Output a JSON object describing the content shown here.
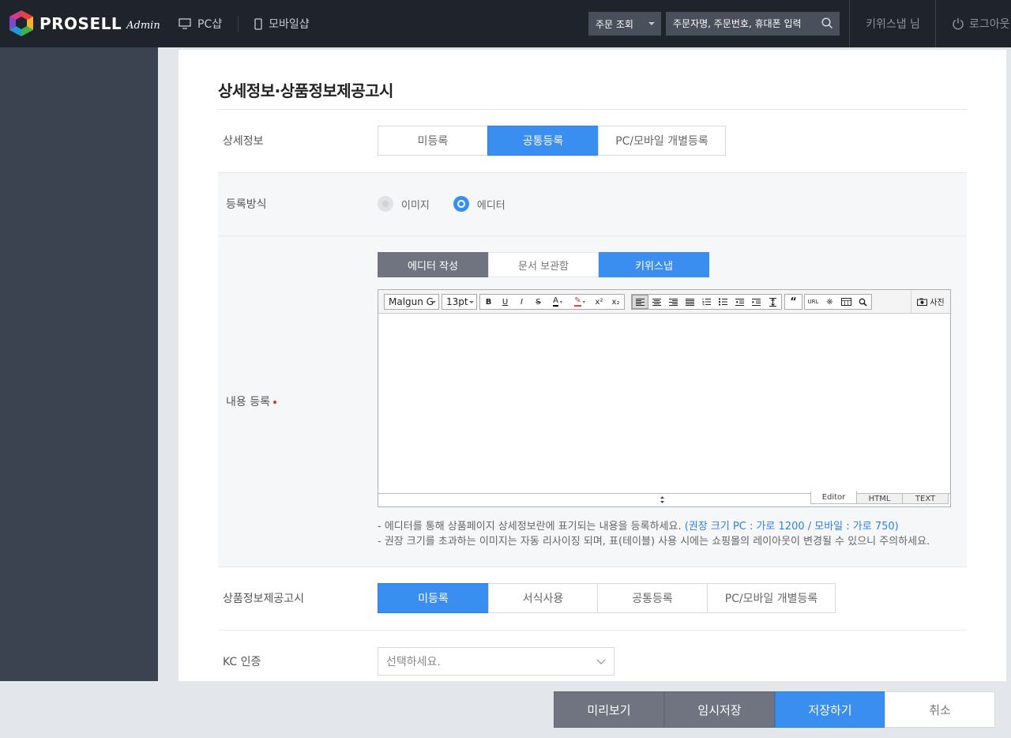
{
  "header": {
    "brand": "PROSELL",
    "brand_sub": "Admin",
    "nav": [
      "PC샵",
      "모바일샵"
    ],
    "order_select": "주문 조회",
    "search_placeholder": "주문자명, 주문번호, 휴대폰 입력",
    "user": "키위스냅 님",
    "logout": "로그아웃"
  },
  "page": {
    "title": "상세정보·상품정보제공고시"
  },
  "detail_info": {
    "label": "상세정보",
    "options": [
      "미등록",
      "공통등록",
      "PC/모바일 개별등록"
    ],
    "selected": "공통등록"
  },
  "register_method": {
    "label": "등록방식",
    "options": [
      "이미지",
      "에디터"
    ],
    "selected": "에디터"
  },
  "content": {
    "label": "내용 등록",
    "tabs": [
      "에디터 작성",
      "문서 보관함",
      "키위스냅"
    ],
    "editor": {
      "font": "Malgun G",
      "size": "13pt",
      "photo_label": "사진",
      "modes": [
        "Editor",
        "HTML",
        "TEXT"
      ],
      "active_mode": "Editor"
    },
    "notes": {
      "line1": "- 에디터를 통해 상품페이지 상세정보란에 표기되는 내용을 등록하세요.",
      "line1_highlight": "(권장 크기 PC : 가로 1200 / 모바일 : 가로 750)",
      "line2": "- 권장 크기를 초과하는 이미지는 자동 리사이징 되며, 표(테이블) 사용 시에는 쇼핑몰의 레이아웃이 변경될 수 있으니 주의하세요."
    }
  },
  "notice": {
    "label": "상품정보제공고시",
    "options": [
      "미등록",
      "서식사용",
      "공통등록",
      "PC/모바일 개별등록"
    ],
    "selected": "미등록"
  },
  "kc": {
    "label": "KC 인증",
    "placeholder": "선택하세요."
  },
  "actions": {
    "preview": "미리보기",
    "temp_save": "임시저장",
    "save": "저장하기",
    "cancel": "취소"
  },
  "colors": {
    "accent": "#3a8ef0",
    "header_bg": "#1e232c",
    "sidebar_bg": "#3b4250",
    "dark_button": "#6f7480"
  }
}
